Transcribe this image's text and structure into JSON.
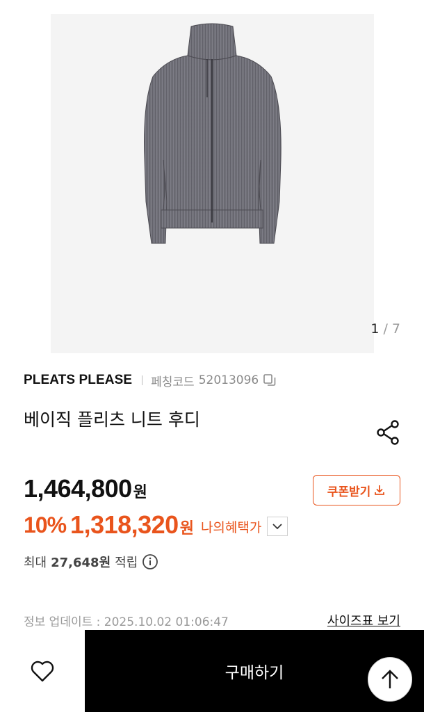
{
  "gallery": {
    "current": "1",
    "separator": "/",
    "total": "7"
  },
  "product": {
    "brand": "PLEATS PLEASE",
    "code_label": "페칭코드",
    "code_value": "52013096",
    "title": "베이직 플리츠 니트 후디"
  },
  "price": {
    "original": "1,464,800",
    "original_unit": "원",
    "discount_rate": "10%",
    "sale": "1,318,320",
    "sale_unit": "원",
    "my_benefit_label": "나의혜택가",
    "coupon_label": "쿠폰받기"
  },
  "points": {
    "prefix": "최대",
    "value": "27,648원",
    "suffix": "적립"
  },
  "meta": {
    "update_info": "정보 업데이트 : 2025.10.02 01:06:47",
    "size_chart_link": "사이즈표 보기"
  },
  "bottom_bar": {
    "buy_label": "구매하기"
  },
  "colors": {
    "accent": "#e9541c",
    "buy_bg": "#000000",
    "hero_bg": "#f4f4f4"
  },
  "icons": [
    "heart-icon",
    "share-icon",
    "copy-icon",
    "download-icon",
    "chevron-down-icon",
    "info-icon",
    "arrow-up-icon"
  ]
}
